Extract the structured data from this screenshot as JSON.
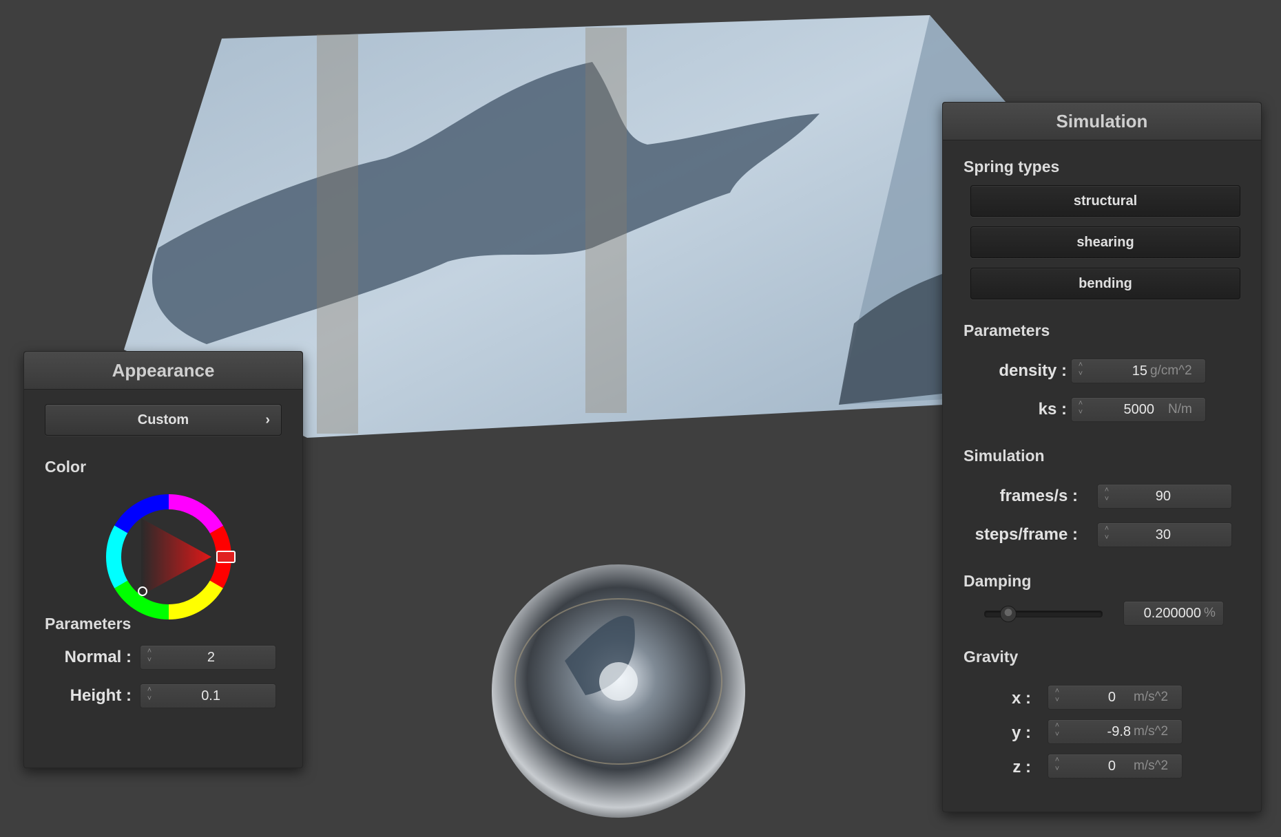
{
  "appearance": {
    "title": "Appearance",
    "preset_label": "Custom",
    "color_label": "Color",
    "parameters_label": "Parameters",
    "normal_label": "Normal :",
    "normal_value": "2",
    "height_label": "Height :",
    "height_value": "0.1",
    "selected_color": "#e02020"
  },
  "simulation": {
    "title": "Simulation",
    "spring_types_label": "Spring types",
    "spring_buttons": [
      "structural",
      "shearing",
      "bending"
    ],
    "parameters_label": "Parameters",
    "density_label": "density :",
    "density_value": "15",
    "density_unit": "g/cm^2",
    "ks_label": "ks :",
    "ks_value": "5000",
    "ks_unit": "N/m",
    "simulation_label": "Simulation",
    "fps_label": "frames/s :",
    "fps_value": "90",
    "steps_label": "steps/frame :",
    "steps_value": "30",
    "damping_label": "Damping",
    "damping_value": "0.200000",
    "damping_unit": "%",
    "damping_level": 0.2,
    "gravity_label": "Gravity",
    "gravity": [
      {
        "label": "x :",
        "value": "0",
        "unit": "m/s^2"
      },
      {
        "label": "y :",
        "value": "-9.8",
        "unit": "m/s^2"
      },
      {
        "label": "z :",
        "value": "0",
        "unit": "m/s^2"
      }
    ]
  }
}
